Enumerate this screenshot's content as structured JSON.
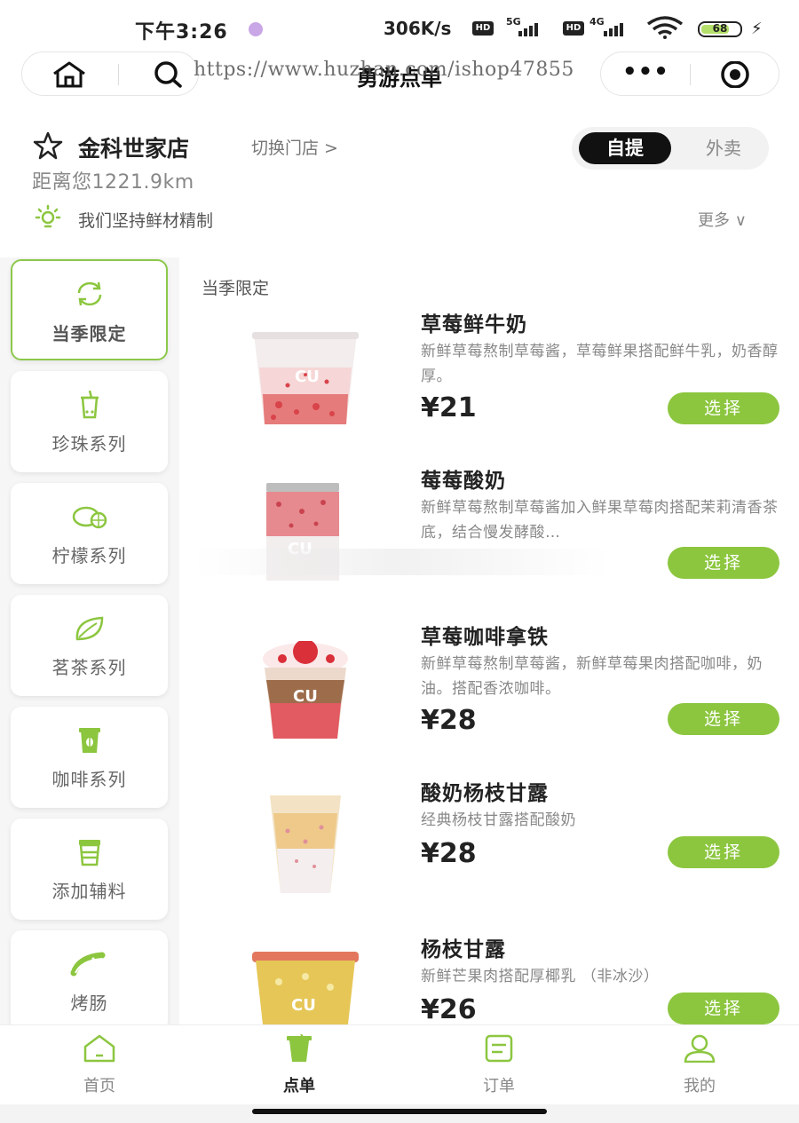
{
  "status_bar": {
    "time": "下午3:26",
    "speed": "306K/s",
    "hd_label": "HD",
    "net1": "5G",
    "net2": "4G",
    "battery": "68",
    "accent_dot_color": "#c9a6e6"
  },
  "nav": {
    "title": "勇游点单",
    "watermark": "https://www.huzhan.com/ishop47855",
    "more_label": "•••",
    "icons": [
      "home-icon",
      "search-icon",
      "more-icon",
      "target-icon"
    ]
  },
  "store": {
    "name": "金科世家店",
    "switch_label": "切换门店 >",
    "distance": "距离您1221.9km",
    "mode_active": "自提",
    "mode_inactive": "外卖",
    "notice": "我们坚持鲜材精制",
    "more_label": "更多 ∨"
  },
  "categories": [
    {
      "label": "当季限定",
      "icon": "refresh-icon",
      "active": true
    },
    {
      "label": "珍珠系列",
      "icon": "bubble-tea-icon",
      "active": false
    },
    {
      "label": "柠檬系列",
      "icon": "lemon-icon",
      "active": false
    },
    {
      "label": "茗茶系列",
      "icon": "leaf-icon",
      "active": false
    },
    {
      "label": "咖啡系列",
      "icon": "coffee-cup-icon",
      "active": false
    },
    {
      "label": "添加辅料",
      "icon": "cup-icon",
      "active": false
    },
    {
      "label": "烤肠",
      "icon": "sausage-icon",
      "active": false
    }
  ],
  "section_title": "当季限定",
  "products": [
    {
      "name": "草莓鲜牛奶",
      "desc": "新鲜草莓熬制草莓酱，草莓鲜果搭配鲜牛乳，奶香醇厚。",
      "price": "¥21",
      "button": "选择"
    },
    {
      "name": "莓莓酸奶",
      "desc": "新鲜草莓熬制草莓酱加入鲜果草莓肉搭配茉莉清香茶底，结合慢发酵酸…",
      "price": "",
      "button": "选择"
    },
    {
      "name": "草莓咖啡拿铁",
      "desc": "新鲜草莓熬制草莓酱，新鲜草莓果肉搭配咖啡，奶油。搭配香浓咖啡。",
      "price": "¥28",
      "button": "选择"
    },
    {
      "name": "酸奶杨枝甘露",
      "desc": "经典杨枝甘露搭配酸奶",
      "price": "¥28",
      "button": "选择"
    },
    {
      "name": "杨枝甘露",
      "desc": "新鲜芒果肉搭配厚椰乳 （非冰沙）",
      "price": "¥26",
      "button": "选择"
    }
  ],
  "tabs": [
    {
      "label": "首页",
      "icon": "home-outline-icon",
      "active": false
    },
    {
      "label": "点单",
      "icon": "order-cup-icon",
      "active": true
    },
    {
      "label": "订单",
      "icon": "receipt-icon",
      "active": false
    },
    {
      "label": "我的",
      "icon": "user-icon",
      "active": false
    }
  ],
  "colors": {
    "accent": "#8cc63f",
    "active_border": "#8cc84b",
    "toggle_active_bg": "#111111"
  }
}
